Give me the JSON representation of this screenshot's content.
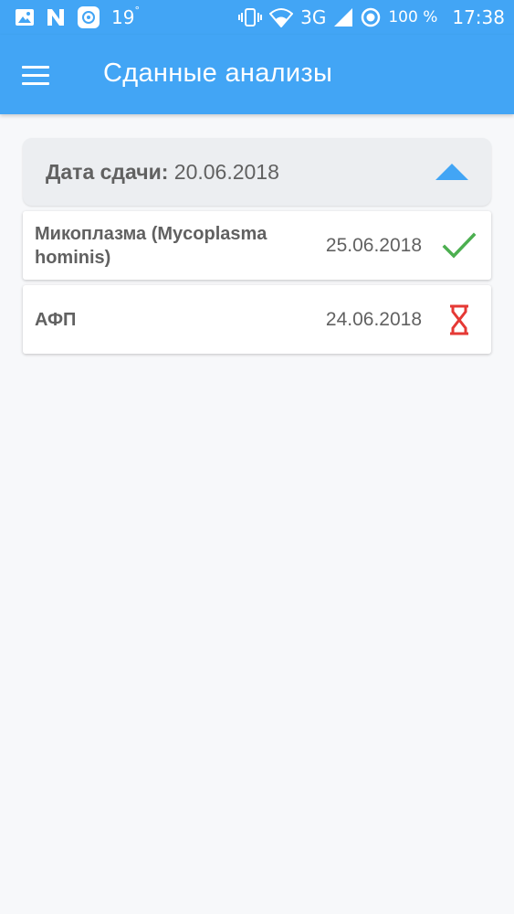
{
  "status_bar": {
    "temperature": "19",
    "degree": "°",
    "network": "3G",
    "battery": "100 %",
    "time": "17:38",
    "icons": [
      "image-icon",
      "n-icon",
      "app-icon",
      "vibrate-icon",
      "wifi-icon",
      "signal-icon",
      "location-icon"
    ]
  },
  "app_bar": {
    "title": "Сданные анализы",
    "menu_icon": "hamburger-menu-icon",
    "color": "#42a5f5"
  },
  "group": {
    "label": "Дата сдачи:",
    "date": "20.06.2018",
    "expanded": true,
    "toggle_icon": "caret-up-icon",
    "toggle_color": "#42a5f5"
  },
  "analyses": [
    {
      "name": "Микоплазма (Mycoplasma hominis)",
      "date": "25.06.2018",
      "status": "ready",
      "status_icon": "checkmark-icon",
      "status_color": "#4caf50"
    },
    {
      "name": "АФП",
      "date": "24.06.2018",
      "status": "pending",
      "status_icon": "hourglass-icon",
      "status_color": "#e53935"
    }
  ]
}
